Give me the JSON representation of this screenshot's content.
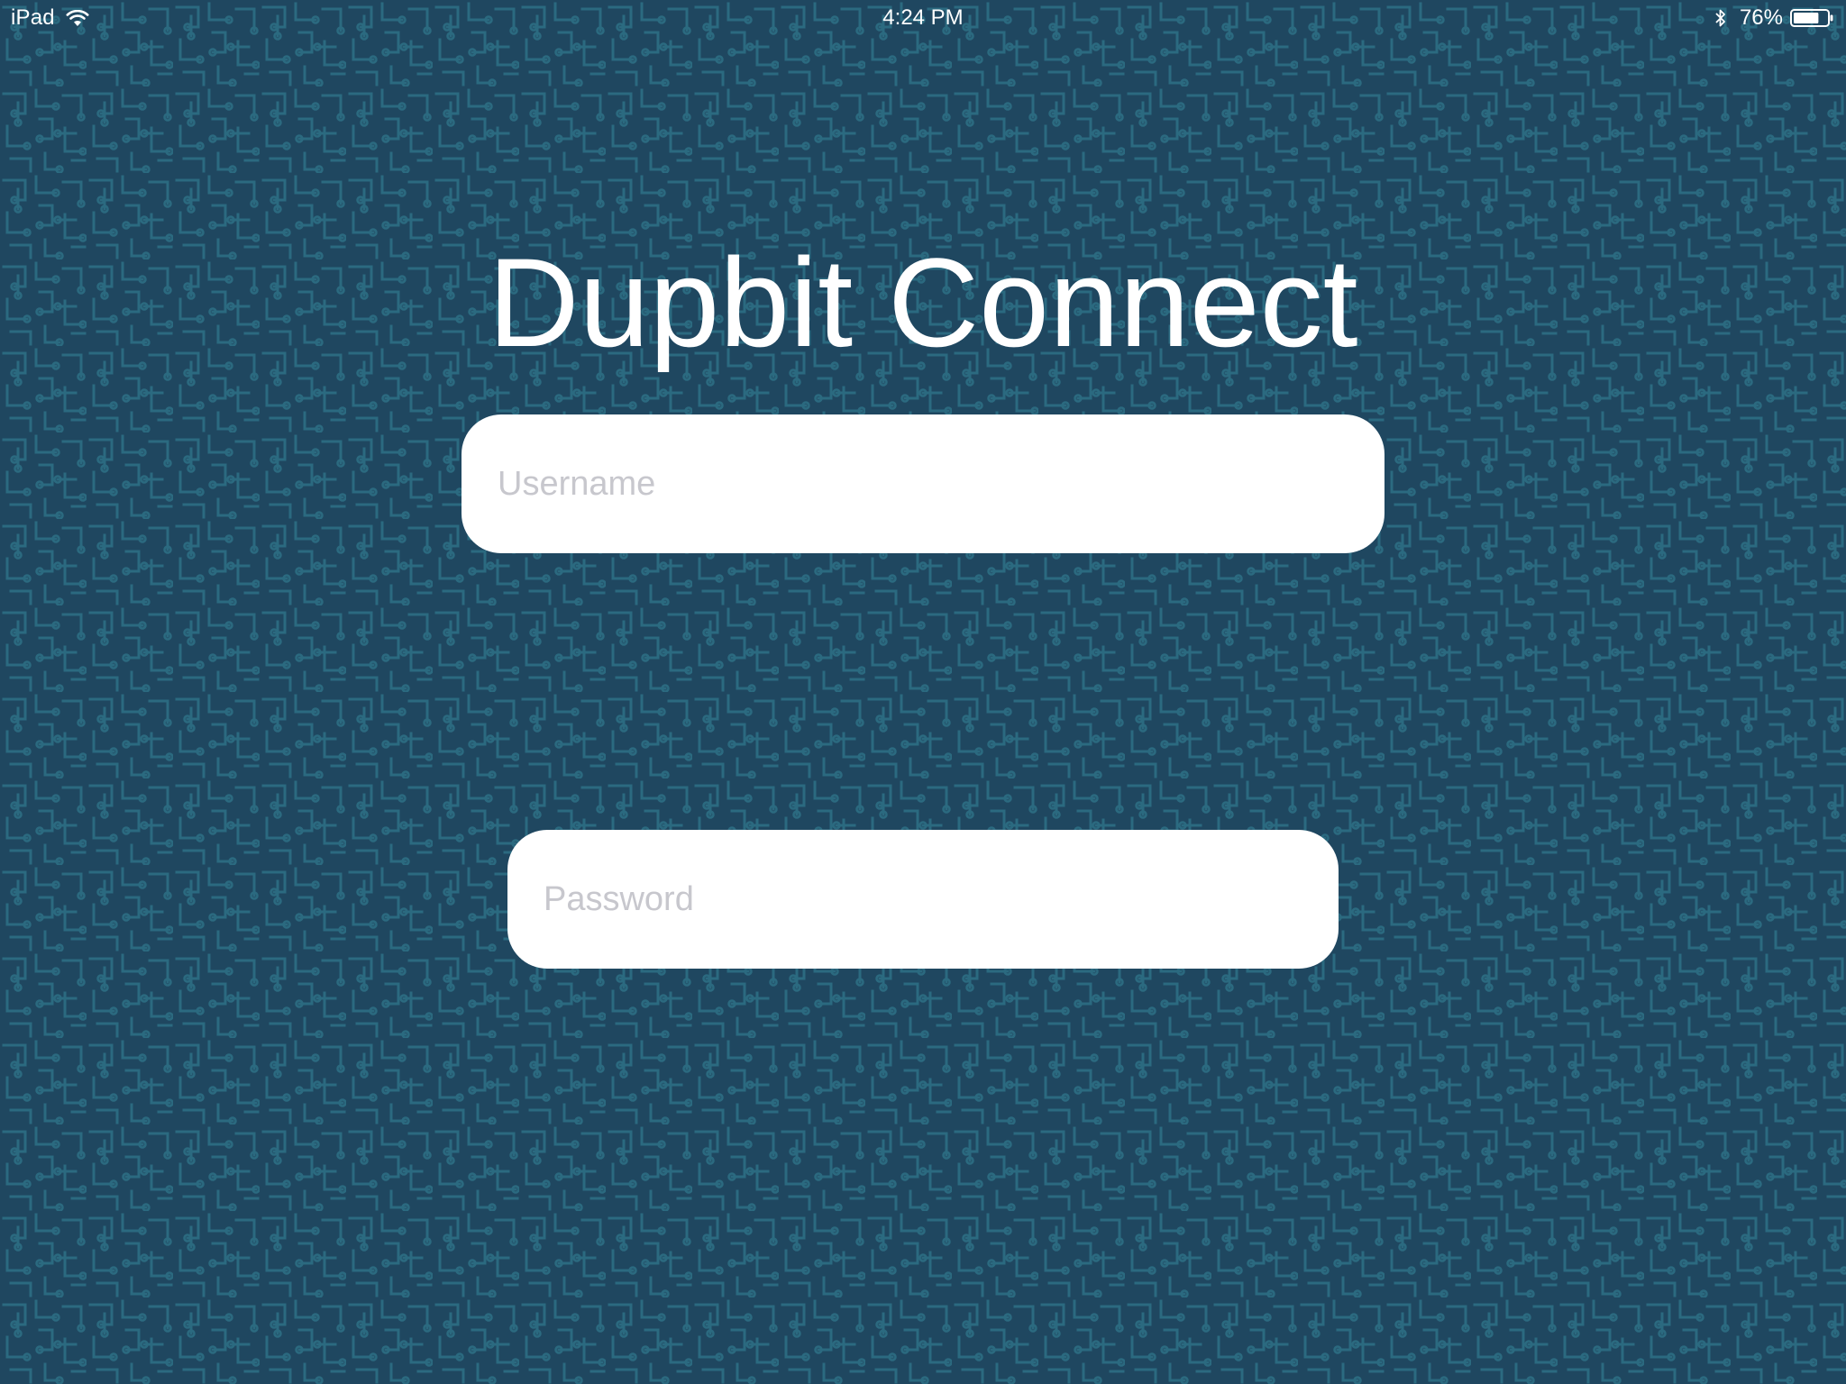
{
  "status_bar": {
    "device": "iPad",
    "time": "4:24 PM",
    "battery": "76%",
    "battery_level": 0.76
  },
  "app": {
    "title": "Dupbit Connect"
  },
  "login": {
    "username_placeholder": "Username",
    "username_value": "",
    "password_placeholder": "Password",
    "password_value": ""
  },
  "colors": {
    "background": "#1f4760",
    "pattern": "#2b6a80",
    "field": "#ffffff",
    "placeholder": "#c7c7cd",
    "text": "#ffffff"
  },
  "icons": [
    "wifi-icon",
    "bluetooth-icon",
    "battery-icon"
  ]
}
